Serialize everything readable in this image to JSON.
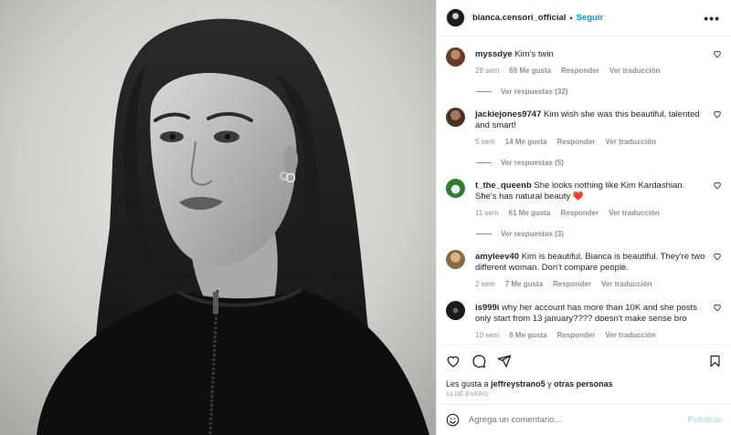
{
  "post": {
    "image_alt": "Black and white portrait photograph"
  },
  "header": {
    "username": "bianca.censori_official",
    "separator": "•",
    "follow_label": "Seguir",
    "more_label": "•••"
  },
  "comments": [
    {
      "username": "myssdye",
      "text": "Kim's twin",
      "time": "28 sem",
      "likes": "69 Me gusta",
      "reply": "Responder",
      "translate": "Ver traducción",
      "view_replies": "Ver respuestas (32)"
    },
    {
      "username": "jackiejones9747",
      "text": "Kim wish she was this beautiful, talented and smart!",
      "time": "5 sem",
      "likes": "14 Me gusta",
      "reply": "Responder",
      "translate": "Ver traducción",
      "view_replies": "Ver respuestas (5)"
    },
    {
      "username": "t_the_queenb",
      "text": "She looks nothing like Kim Kardashian. She's has natural beauty",
      "emoji": "❤️",
      "time": "11 sem",
      "likes": "61 Me gusta",
      "reply": "Responder",
      "translate": "Ver traducción",
      "view_replies": "Ver respuestas (3)"
    },
    {
      "username": "amyleev40",
      "text": "Kim is beautiful. Bianca is beautiful. They're two different woman. Don't compare people.",
      "time": "2 sem",
      "likes": "7 Me gusta",
      "reply": "Responder",
      "translate": "Ver traducción"
    },
    {
      "username": "is999i",
      "text": "why her account has more than 10K and she posts only start from 13 january???? doesn't make sense bro",
      "time": "10 sem",
      "likes": "6 Me gusta",
      "reply": "Responder",
      "translate": "Ver traducción"
    }
  ],
  "likes_line": {
    "prefix": "Les gusta a",
    "user": "jeffreystrano5",
    "conj": "y",
    "others": "otras personas"
  },
  "date": "13 DE ENERO",
  "add_comment": {
    "placeholder": "Agrega un comentario...",
    "publish_label": "Publicar"
  },
  "icons": [
    "heart-icon",
    "comment-icon",
    "share-icon",
    "bookmark-icon",
    "emoji-icon",
    "more-icon"
  ],
  "colors": {
    "accent": "#0095f6",
    "muted": "#8e8e8e",
    "publish_disabled": "#b2dffc",
    "emoji_heart": "#e0245e"
  }
}
